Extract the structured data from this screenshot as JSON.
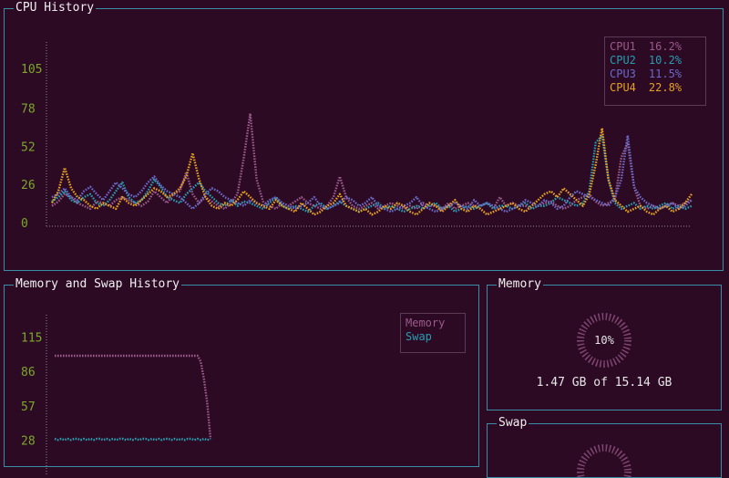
{
  "cpu_panel": {
    "title": "CPU History"
  },
  "mem_history_panel": {
    "title": "Memory and Swap History"
  },
  "memory_panel": {
    "title": "Memory",
    "percent_label": "10%",
    "usage_text": "1.47 GB of 15.14 GB"
  },
  "swap_panel": {
    "title": "Swap"
  },
  "colors": {
    "background": "#2c0a24",
    "border": "#3a8ea8",
    "tick": "#7aa82a",
    "cpu1": "#9a5a8a",
    "cpu2": "#2a9cb0",
    "cpu3": "#6a6ac8",
    "cpu4": "#e6a020",
    "memory": "#9a5a8a",
    "swap": "#2a9cb0"
  },
  "cpu_legend": [
    {
      "name": "CPU1",
      "value": "16.2%"
    },
    {
      "name": "CPU2",
      "value": "10.2%"
    },
    {
      "name": "CPU3",
      "value": "11.5%"
    },
    {
      "name": "CPU4",
      "value": "22.8%"
    }
  ],
  "mem_legend": [
    {
      "name": "Memory"
    },
    {
      "name": "Swap"
    }
  ],
  "chart_data": [
    {
      "type": "line",
      "ylim": [
        0,
        120
      ],
      "y_ticks": [
        "105",
        "78",
        "52",
        "26",
        "0"
      ],
      "series": [
        {
          "name": "CPU1",
          "values": [
            12,
            15,
            20,
            18,
            14,
            12,
            10,
            15,
            14,
            12,
            16,
            18,
            16,
            14,
            12,
            15,
            22,
            18,
            14,
            20,
            22,
            35,
            20,
            14,
            18,
            15,
            12,
            10,
            14,
            20,
            45,
            75,
            30,
            15,
            12,
            10,
            14,
            12,
            15,
            18,
            14,
            12,
            10,
            12,
            18,
            32,
            18,
            12,
            10,
            12,
            14,
            10,
            12,
            14,
            12,
            10,
            12,
            10,
            14,
            12,
            12,
            10,
            14,
            10,
            12,
            14,
            12,
            12,
            14,
            10,
            18,
            12,
            14,
            12,
            12,
            10,
            12,
            14,
            15,
            12,
            10,
            12,
            16,
            18,
            20,
            15,
            12,
            14,
            16,
            45,
            55,
            25,
            12,
            10,
            12,
            10,
            12,
            14,
            12,
            14,
            16
          ]
        },
        {
          "name": "CPU2",
          "values": [
            15,
            18,
            22,
            16,
            14,
            18,
            20,
            14,
            12,
            16,
            22,
            28,
            18,
            14,
            16,
            22,
            30,
            25,
            18,
            16,
            14,
            20,
            24,
            28,
            22,
            18,
            14,
            12,
            16,
            12,
            15,
            14,
            12,
            10,
            14,
            18,
            12,
            10,
            12,
            10,
            8,
            12,
            14,
            10,
            12,
            15,
            12,
            10,
            8,
            10,
            12,
            14,
            10,
            12,
            10,
            8,
            10,
            12,
            10,
            12,
            14,
            10,
            12,
            8,
            10,
            12,
            10,
            12,
            14,
            10,
            12,
            12,
            10,
            12,
            14,
            10,
            12,
            12,
            14,
            18,
            16,
            14,
            12,
            14,
            22,
            55,
            60,
            30,
            14,
            10,
            12,
            14,
            10,
            12,
            10,
            12,
            14,
            10,
            12,
            10,
            12
          ]
        },
        {
          "name": "CPU3",
          "values": [
            18,
            20,
            24,
            18,
            16,
            22,
            25,
            20,
            16,
            22,
            28,
            24,
            20,
            18,
            22,
            28,
            32,
            26,
            22,
            20,
            18,
            14,
            10,
            14,
            20,
            24,
            22,
            18,
            16,
            14,
            12,
            16,
            14,
            12,
            16,
            18,
            14,
            12,
            10,
            12,
            14,
            18,
            12,
            10,
            12,
            14,
            18,
            16,
            12,
            14,
            18,
            12,
            10,
            8,
            10,
            12,
            14,
            18,
            12,
            10,
            8,
            10,
            12,
            14,
            12,
            10,
            16,
            12,
            14,
            12,
            10,
            8,
            10,
            12,
            16,
            14,
            12,
            16,
            14,
            10,
            12,
            18,
            22,
            20,
            18,
            16,
            14,
            12,
            18,
            30,
            60,
            25,
            18,
            14,
            12,
            10,
            12,
            14,
            10,
            12,
            16
          ]
        },
        {
          "name": "CPU4",
          "values": [
            14,
            22,
            38,
            24,
            18,
            16,
            12,
            10,
            14,
            12,
            10,
            18,
            14,
            12,
            16,
            20,
            24,
            22,
            18,
            20,
            24,
            32,
            48,
            30,
            18,
            12,
            10,
            14,
            12,
            16,
            22,
            18,
            14,
            12,
            10,
            16,
            12,
            10,
            8,
            14,
            10,
            6,
            8,
            12,
            14,
            20,
            12,
            10,
            8,
            10,
            6,
            8,
            12,
            10,
            14,
            12,
            8,
            6,
            10,
            14,
            12,
            8,
            12,
            16,
            10,
            8,
            12,
            10,
            6,
            8,
            10,
            12,
            14,
            10,
            8,
            12,
            16,
            20,
            22,
            18,
            24,
            20,
            16,
            12,
            20,
            40,
            65,
            30,
            16,
            12,
            8,
            10,
            12,
            8,
            6,
            10,
            12,
            8,
            10,
            14,
            20
          ]
        }
      ]
    },
    {
      "type": "line",
      "ylim": [
        0,
        130
      ],
      "y_ticks": [
        "115",
        "86",
        "57",
        "28"
      ],
      "series": [
        {
          "name": "Memory",
          "values": [
            100,
            100,
            100,
            100,
            100,
            100,
            100,
            100,
            100,
            100,
            100,
            100,
            100,
            100,
            100,
            100,
            100,
            100,
            100,
            100,
            100,
            100,
            100,
            100,
            100,
            100,
            100,
            100,
            100,
            100,
            100,
            100,
            100,
            100,
            100,
            100,
            100,
            100,
            100,
            100,
            100,
            100,
            100,
            100,
            100,
            95,
            80,
            60,
            30
          ]
        },
        {
          "name": "Swap",
          "values": [
            30,
            29,
            30,
            29,
            30,
            29,
            30,
            30,
            29,
            30,
            29,
            30,
            29,
            30,
            30,
            29,
            30,
            29,
            30,
            29,
            30,
            30,
            29,
            30,
            29,
            30,
            29,
            30,
            30,
            29,
            30,
            29,
            30,
            29,
            30,
            30,
            29,
            30,
            29,
            30,
            29,
            30,
            30,
            29,
            30,
            29,
            30,
            29,
            30
          ]
        }
      ]
    }
  ]
}
